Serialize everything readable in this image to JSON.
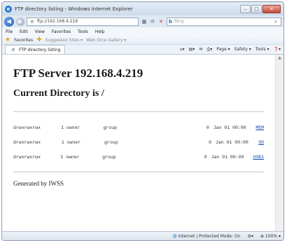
{
  "window": {
    "title": "FTP directory listing - Windows Internet Explorer",
    "minimize": "–",
    "maximize": "□",
    "close": "✕"
  },
  "address": {
    "url": "ftp://192.168.4.219",
    "search_engine": "b",
    "search_placeholder": "Bing"
  },
  "menu": [
    "File",
    "Edit",
    "View",
    "Favorites",
    "Tools",
    "Help"
  ],
  "favorites": {
    "label": "Favorites",
    "suggested": "Suggested Sites ▾",
    "webslice": "Web Slice Gallery ▾"
  },
  "tab": {
    "title": "FTP directory listing"
  },
  "toolbar": {
    "page": "Page ▾",
    "safety": "Safety ▾",
    "tools": "Tools ▾",
    "help": "❓▾"
  },
  "content": {
    "server_heading": "FTP Server 192.168.4.219",
    "directory_heading": "Current Directory is /",
    "entries": [
      {
        "perm": "drwxrwxrwx",
        "links": "1 owner",
        "group": "group",
        "size": "0",
        "date": "Jan 01 00:00",
        "name": "MEM"
      },
      {
        "perm": "drwxrwxrwx",
        "links": "1 owner",
        "group": "group",
        "size": "0",
        "date": "Jan 01 00:00",
        "name": "SD"
      },
      {
        "perm": "drwxrwxrwx",
        "links": "1 owner",
        "group": "group",
        "size": "0",
        "date": "Jan 01 00:00",
        "name": "USB1"
      }
    ],
    "footer": "Generated by IWSS"
  },
  "status": {
    "zone": "Internet | Protected Mode: On",
    "zoom": "100%"
  }
}
